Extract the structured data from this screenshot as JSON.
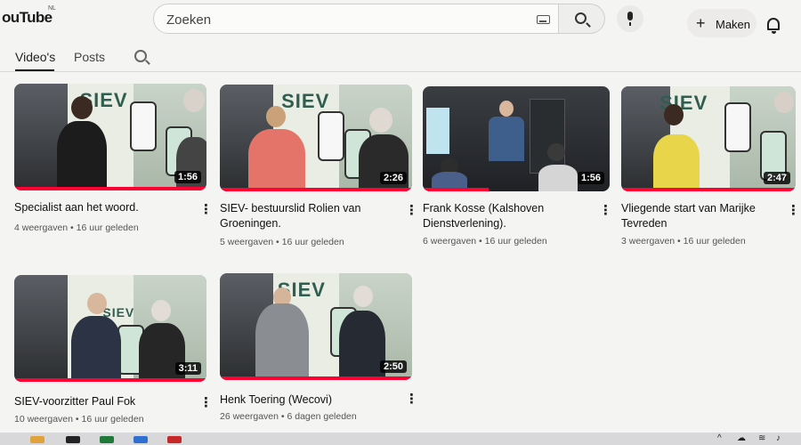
{
  "header": {
    "logo_text": "ouTube",
    "logo_region": "NL",
    "search_placeholder": "Zoeken",
    "create_label": "Maken",
    "create_icon": "plus-icon",
    "icons": [
      "keyboard-icon",
      "search-icon",
      "mic-icon",
      "bell-icon"
    ]
  },
  "tabs": {
    "videos": "Video's",
    "posts": "Posts"
  },
  "videos": [
    {
      "title": "Specialist aan het woord.",
      "views": "4 weergaven",
      "age": "16 uur geleden",
      "duration": "1:56"
    },
    {
      "title": "SIEV- bestuurslid Rolien van Groeningen.",
      "views": "5 weergaven",
      "age": "16 uur geleden",
      "duration": "2:26"
    },
    {
      "title": "Frank Kosse (Kalshoven Dienstverlening).",
      "views": "6 weergaven",
      "age": "16 uur geleden",
      "duration": "1:56"
    },
    {
      "title": "Vliegende start van Marijke Tevreden",
      "views": "3 weergaven",
      "age": "16 uur geleden",
      "duration": "2:47"
    },
    {
      "title": "SIEV-voorzitter Paul Fok",
      "views": "10 weergaven",
      "age": "16 uur geleden",
      "duration": "3:11"
    },
    {
      "title": "Henk Toering (Wecovi)",
      "views": "26 weergaven",
      "age": "6 dagen geleden",
      "duration": "2:50"
    }
  ],
  "colors": {
    "accent": "#ff0033",
    "banner_text": "#2f5d50"
  }
}
